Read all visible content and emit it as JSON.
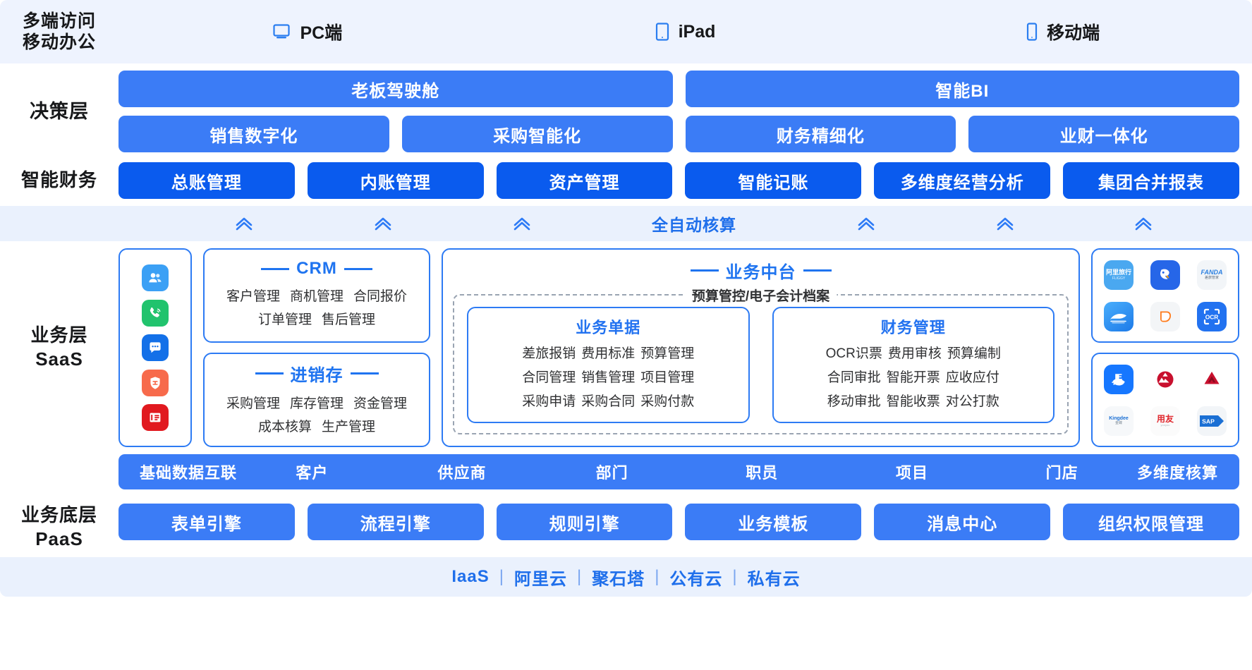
{
  "header": {
    "label_line1": "多端访问",
    "label_line2": "移动办公",
    "devices": [
      {
        "icon": "desktop-icon",
        "label": "PC端"
      },
      {
        "icon": "tablet-icon",
        "label": "iPad"
      },
      {
        "icon": "mobile-icon",
        "label": "移动端"
      }
    ]
  },
  "decision": {
    "label": "决策层",
    "top": [
      "老板驾驶舱",
      "智能BI"
    ],
    "bottom": [
      "销售数字化",
      "采购智能化",
      "财务精细化",
      "业财一体化"
    ]
  },
  "finance": {
    "label": "智能财务",
    "items": [
      "总账管理",
      "内账管理",
      "资产管理",
      "智能记账",
      "多维度经营分析",
      "集团合并报表"
    ]
  },
  "autostrip": {
    "label": "全自动核算",
    "chevron_count": 6
  },
  "business": {
    "label_line1": "业务层",
    "label_line2": "SaaS",
    "app_icons": [
      {
        "name": "contacts-icon",
        "color": "#3bA0f5"
      },
      {
        "name": "phone-call-icon",
        "color": "#21c36d"
      },
      {
        "name": "chat-message-icon",
        "color": "#1370e8"
      },
      {
        "name": "shield-work-icon",
        "color": "#f76a4b"
      },
      {
        "name": "document-list-icon",
        "color": "#e1191f"
      }
    ],
    "modules": [
      {
        "title": "CRM",
        "lines": [
          [
            "客户管理",
            "商机管理",
            "合同报价"
          ],
          [
            "订单管理",
            "售后管理"
          ]
        ]
      },
      {
        "title": "进销存",
        "lines": [
          [
            "采购管理",
            "库存管理",
            "资金管理"
          ],
          [
            "成本核算",
            "生产管理"
          ]
        ]
      }
    ],
    "middle": {
      "title": "业务中台",
      "dash_caption": "预算管控/电子会计档案",
      "subcards": [
        {
          "title": "业务单据",
          "lines": [
            [
              "差旅报销",
              "费用标准",
              "预算管理"
            ],
            [
              "合同管理",
              "销售管理",
              "项目管理"
            ],
            [
              "采购申请",
              "采购合同",
              "采购付款"
            ]
          ]
        },
        {
          "title": "财务管理",
          "lines": [
            [
              "OCR识票",
              "费用审核",
              "预算编制"
            ],
            [
              "合同审批",
              "智能开票",
              "应收应付"
            ],
            [
              "移动审批",
              "智能收票",
              "对公打款"
            ]
          ]
        }
      ]
    },
    "logo_groups": [
      {
        "group": "travel-partners",
        "logos": [
          {
            "name": "alitrip-logo",
            "text": "阿里旅行",
            "sub": "FLIGGY",
            "bg": "#4aa8f0",
            "fg": "#ffffff"
          },
          {
            "name": "ctrip-logo",
            "text": "携程",
            "sub": "",
            "bg": "#2666e8",
            "fg": "#ffffff"
          },
          {
            "name": "panda-travel-logo",
            "text": "FANDA",
            "sub": "差旅管家",
            "bg": "#f2f5f8",
            "fg": "#2a7fe0"
          },
          {
            "name": "train-ticket-logo",
            "text": "高铁",
            "sub": "",
            "bg": "#2a8ef0",
            "fg": "#ffffff"
          },
          {
            "name": "didi-logo",
            "text": "滴滴",
            "sub": "",
            "bg": "#f3f5f7",
            "fg": "#ff7a1a"
          },
          {
            "name": "ocr-logo",
            "text": "OCR",
            "sub": "",
            "bg": "#2272f0",
            "fg": "#ffffff"
          }
        ]
      },
      {
        "group": "finance-partners",
        "logos": [
          {
            "name": "alipay-logo",
            "text": "支",
            "sub": "",
            "bg": "#1677ff",
            "fg": "#ffffff"
          },
          {
            "name": "cmb-bank-logo",
            "text": "招商银行",
            "sub": "",
            "bg": "#ffffff",
            "fg": "#c8102e"
          },
          {
            "name": "cmbc-bank-logo",
            "text": "民生银行",
            "sub": "",
            "bg": "#ffffff",
            "fg": "#c8102e"
          },
          {
            "name": "kingdee-logo",
            "text": "Kingdee",
            "sub": "金蝶",
            "bg": "#f6f8fa",
            "fg": "#1a6fd4"
          },
          {
            "name": "yonyou-logo",
            "text": "用友",
            "sub": "yonyou",
            "bg": "#fbfbfb",
            "fg": "#e0262c"
          },
          {
            "name": "sap-logo",
            "text": "SAP",
            "sub": "",
            "bg": "#f2f5f8",
            "fg": "#1a6fd4"
          }
        ]
      }
    ]
  },
  "base_data": {
    "title": "基础数据互联",
    "items": [
      "客户",
      "供应商",
      "部门",
      "职员",
      "项目",
      "门店",
      "多维度核算"
    ]
  },
  "paas": {
    "label_line1": "业务底层",
    "label_line2": "PaaS",
    "items": [
      "表单引擎",
      "流程引擎",
      "规则引擎",
      "业务模板",
      "消息中心",
      "组织权限管理"
    ]
  },
  "footer": {
    "items": [
      "IaaS",
      "阿里云",
      "聚石塔",
      "公有云",
      "私有云"
    ],
    "separator": "|"
  },
  "colors": {
    "primary_blue": "#3b7cf6",
    "deep_blue": "#0a5bee",
    "strip_bg": "#eaf1fd",
    "header_bg": "#eef3fe",
    "border_blue": "#2d7bf4",
    "text_dark": "#17181a"
  }
}
